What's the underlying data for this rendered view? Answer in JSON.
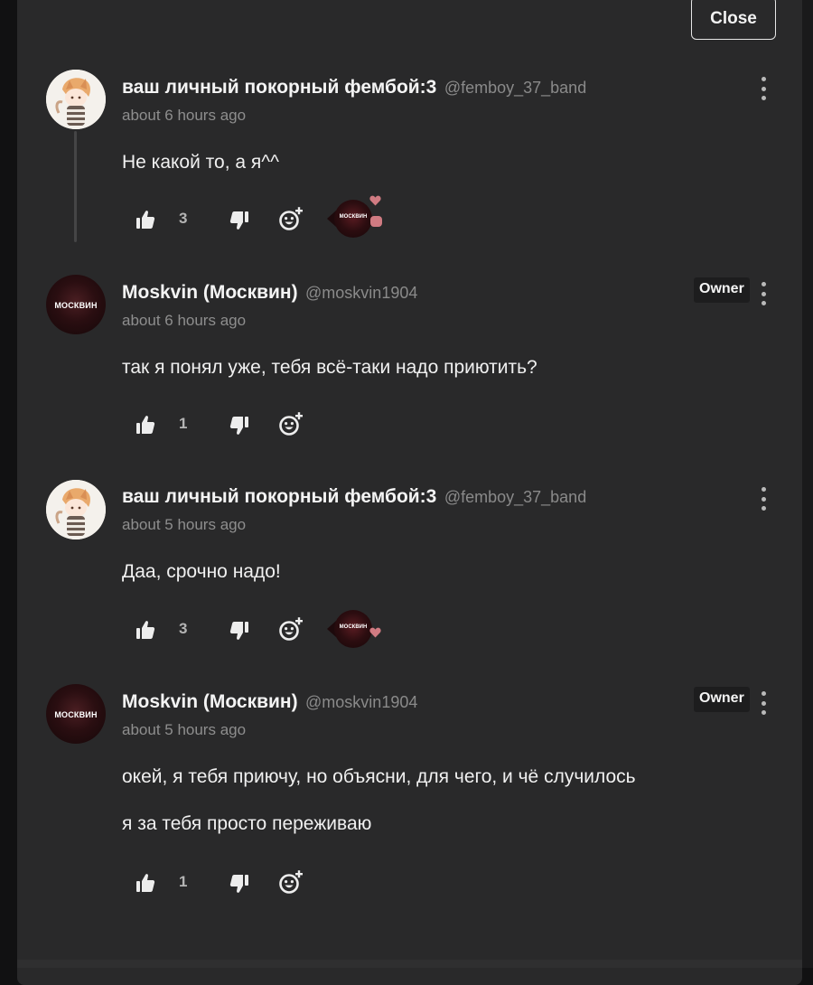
{
  "modal": {
    "close_label": "Close"
  },
  "colors": {
    "background": "#29292a",
    "text": "#f0f0f0",
    "muted": "#8e8e8e",
    "reaction_accent": "#d07b82"
  },
  "comments": [
    {
      "author_name": "ваш личный покорный фембой:3",
      "author_handle": "@femboy_37_band",
      "timestamp": "about 6 hours ago",
      "owner_badge": "",
      "paragraphs": [
        "Не какой то, а я^^"
      ],
      "likes": "3",
      "reaction_avatar_text": "МОСКВИН",
      "reactions": [
        "heart-icon",
        "speech-bubble-icon"
      ]
    },
    {
      "author_name": "Moskvin (Москвин)",
      "author_handle": "@moskvin1904",
      "timestamp": "about 6 hours ago",
      "owner_badge": "Owner",
      "avatar_text": "МОСКВИН",
      "paragraphs": [
        "так я понял уже, тебя всё-таки надо приютить?"
      ],
      "likes": "1"
    },
    {
      "author_name": "ваш личный покорный фембой:3",
      "author_handle": "@femboy_37_band",
      "timestamp": "about 5 hours ago",
      "owner_badge": "",
      "paragraphs": [
        "Даа, срочно надо!"
      ],
      "likes": "3",
      "reaction_avatar_text": "МОСКВИН",
      "reactions": [
        "heart-icon"
      ]
    },
    {
      "author_name": "Moskvin (Москвин)",
      "author_handle": "@moskvin1904",
      "timestamp": "about 5 hours ago",
      "owner_badge": "Owner",
      "avatar_text": "МОСКВИН",
      "paragraphs": [
        "окей, я тебя приючу, но объясни, для чего, и чё случилось",
        "я за тебя просто переживаю"
      ],
      "likes": "1"
    }
  ]
}
